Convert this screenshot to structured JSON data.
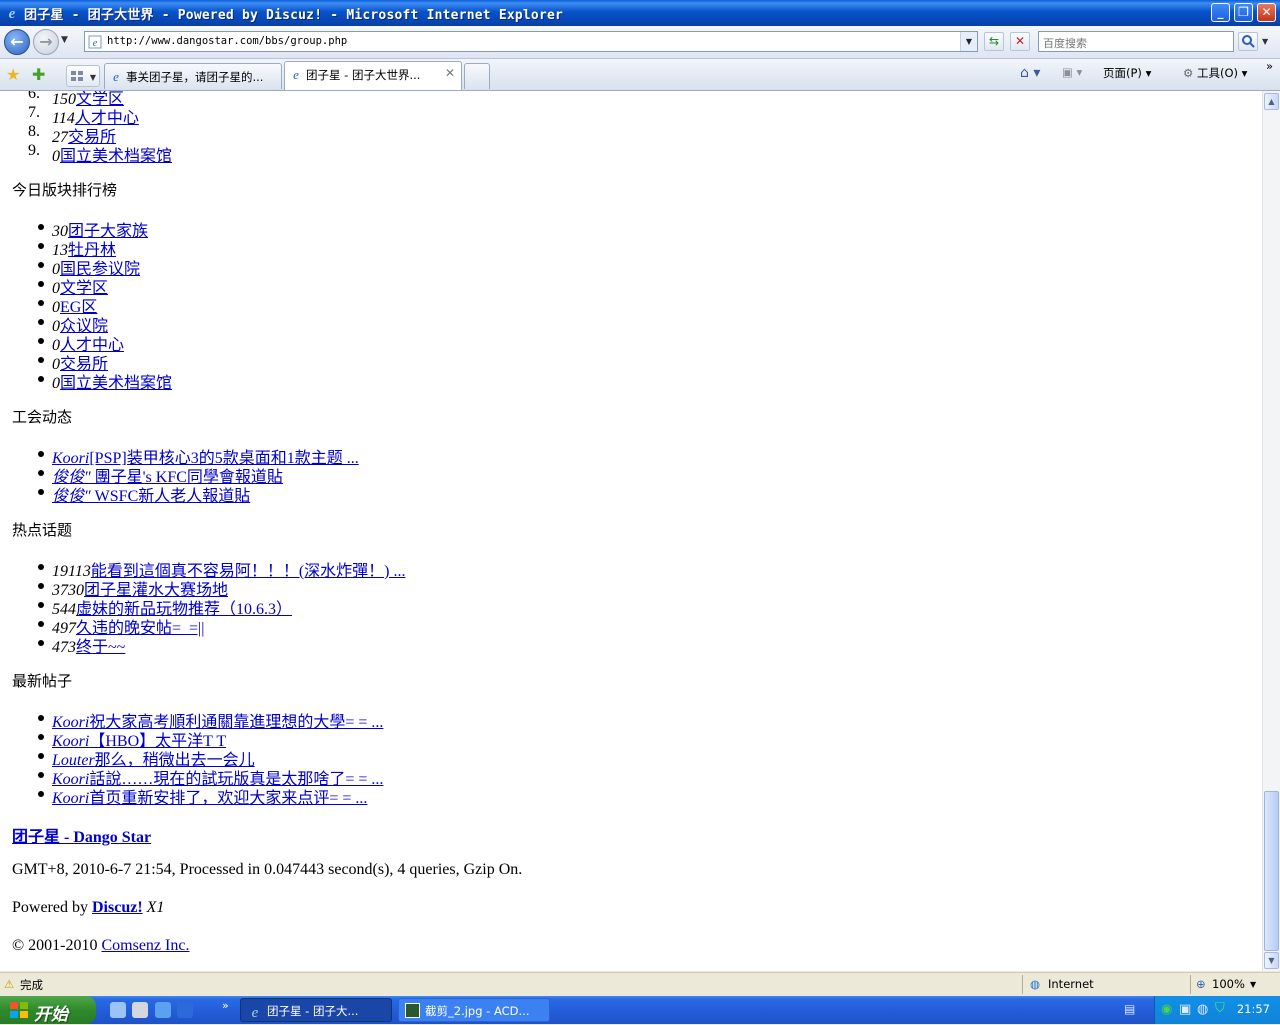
{
  "window": {
    "title": "团子星 - 团子大世界 - Powered by Discuz! - Microsoft Internet Explorer"
  },
  "address_bar": {
    "url": "http://www.dangostar.com/bbs/group.php"
  },
  "search": {
    "placeholder": "百度搜索"
  },
  "tabs": [
    {
      "label": "事关团子星，请团子星的..."
    },
    {
      "label": "团子星 - 团子大世界..."
    }
  ],
  "commands": {
    "page": "页面(P)",
    "tools": "工具(O)"
  },
  "content": {
    "top_list": [
      {
        "num": "6.",
        "count": "150",
        "label": "文学区"
      },
      {
        "num": "7.",
        "count": "114",
        "label": "人才中心"
      },
      {
        "num": "8.",
        "count": "27",
        "label": "交易所"
      },
      {
        "num": "9.",
        "count": "0",
        "label": "国立美术档案馆"
      }
    ],
    "today_rank": {
      "heading": "今日版块排行榜",
      "items": [
        {
          "count": "30",
          "label": "团子大家族"
        },
        {
          "count": "13",
          "label": "牡丹林"
        },
        {
          "count": "0",
          "label": "国民参议院"
        },
        {
          "count": "0",
          "label": "文学区"
        },
        {
          "count": "0",
          "label": "EG区"
        },
        {
          "count": "0",
          "label": "众议院"
        },
        {
          "count": "0",
          "label": "人才中心"
        },
        {
          "count": "0",
          "label": "交易所"
        },
        {
          "count": "0",
          "label": "国立美术档案馆"
        }
      ]
    },
    "guild": {
      "heading": "工会动态",
      "items": [
        {
          "user": "Koori",
          "title": "[PSP]装甲核心3的5款桌面和1款主题 ..."
        },
        {
          "user": "俊俊″",
          "title": " 團子星's KFC同學會報道貼"
        },
        {
          "user": "俊俊″",
          "title": " WSFC新人老人報道貼"
        }
      ]
    },
    "hot": {
      "heading": "热点话题",
      "items": [
        {
          "count": "19113",
          "title": "能看到這個真不容易阿！！！(深水炸彈！) ..."
        },
        {
          "count": "3730",
          "title": "团子星灌水大赛场地"
        },
        {
          "count": "544",
          "title": "虚妹的新品玩物推荐（10.6.3）"
        },
        {
          "count": "497",
          "title": "久违的晚安帖=_=||"
        },
        {
          "count": "473",
          "title": "终于~~"
        }
      ]
    },
    "latest": {
      "heading": "最新帖子",
      "items": [
        {
          "user": "Koori",
          "title": "祝大家高考順利通關靠進理想的大學= = ..."
        },
        {
          "user": "Koori",
          "title": "【HBO】太平洋T T"
        },
        {
          "user": "Louter",
          "title": "那么，稍微出去一会儿"
        },
        {
          "user": "Koori",
          "title": "話說……現在的試玩版真是太那啥了= = ..."
        },
        {
          "user": "Koori",
          "title": "首页重新安排了，欢迎大家来点评= = ..."
        }
      ]
    },
    "footer": {
      "site_link": "团子星 - Dango Star",
      "stats": "GMT+8, 2010-6-7 21:54, Processed in 0.047443 second(s), 4 queries, Gzip On.",
      "powered_prefix": "Powered by ",
      "powered_link": "Discuz!",
      "powered_version": " X1",
      "copyright_prefix": "© 2001-2010 ",
      "copyright_link": "Comsenz Inc."
    }
  },
  "statusbar": {
    "status": "完成",
    "zone": "Internet",
    "zoom": "100%"
  },
  "taskbar": {
    "start": "开始",
    "tasks": [
      {
        "label": "团子星 - 团子大..."
      },
      {
        "label": "截剪_2.jpg - ACD..."
      }
    ],
    "clock": "21:57"
  }
}
